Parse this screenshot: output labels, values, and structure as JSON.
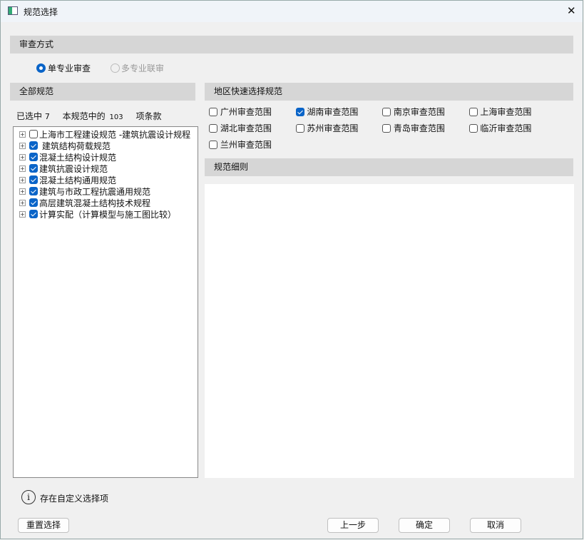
{
  "window": {
    "title": "规范选择",
    "close": "✕"
  },
  "review_mode": {
    "header": "审查方式",
    "options": [
      {
        "label": "单专业审查",
        "selected": true,
        "enabled": true
      },
      {
        "label": "多专业联审",
        "selected": false,
        "enabled": false
      }
    ]
  },
  "all_specs": {
    "header": "全部规范",
    "selected_prefix": "已选中",
    "selected_count": "7",
    "mid_text": "本规范中的",
    "total_count": "103",
    "suffix": "项条款",
    "items": [
      {
        "label": "上海市工程建设规范 -建筑抗震设计规程",
        "checked": false
      },
      {
        "label": " 建筑结构荷载规范",
        "checked": true
      },
      {
        "label": "混凝土结构设计规范",
        "checked": true
      },
      {
        "label": "建筑抗震设计规范",
        "checked": true
      },
      {
        "label": "混凝土结构通用规范",
        "checked": true
      },
      {
        "label": "建筑与市政工程抗震通用规范",
        "checked": true
      },
      {
        "label": "高层建筑混凝土结构技术规程",
        "checked": true
      },
      {
        "label": "计算实配（计算模型与施工图比较）",
        "checked": true
      }
    ]
  },
  "regions": {
    "header": "地区快速选择规范",
    "items": [
      {
        "label": "广州审查范围",
        "checked": false
      },
      {
        "label": "湖南审查范围",
        "checked": true
      },
      {
        "label": "南京审查范围",
        "checked": false
      },
      {
        "label": "上海审查范围",
        "checked": false
      },
      {
        "label": "湖北审查范围",
        "checked": false
      },
      {
        "label": "苏州审查范围",
        "checked": false
      },
      {
        "label": "青岛审查范围",
        "checked": false
      },
      {
        "label": "临沂审查范围",
        "checked": false
      },
      {
        "label": "兰州审查范围",
        "checked": false
      }
    ]
  },
  "details": {
    "header": "规范细则"
  },
  "info": {
    "text": "存在自定义选择项",
    "icon": "i"
  },
  "buttons": {
    "reset": "重置选择",
    "prev": "上一步",
    "ok": "确定",
    "cancel": "取消"
  }
}
